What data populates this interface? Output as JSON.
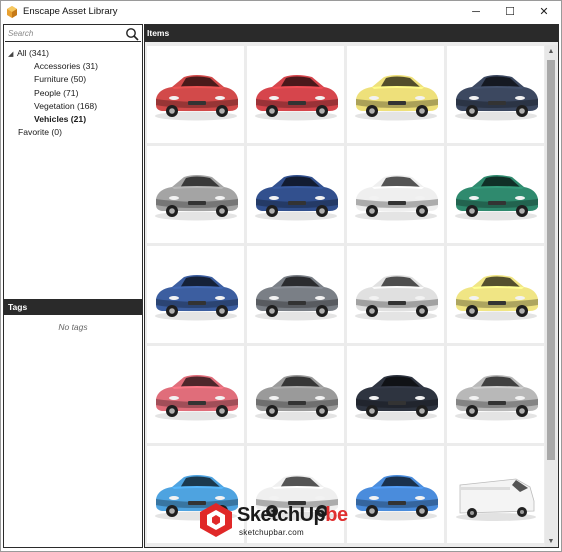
{
  "window": {
    "title": "Enscape Asset Library",
    "min_glyph": "─",
    "max_glyph": "☐",
    "close_glyph": "✕"
  },
  "search": {
    "placeholder": "Search",
    "value": ""
  },
  "tree": {
    "root": "All (341)",
    "children": [
      "Accessories (31)",
      "Furniture (50)",
      "People (71)",
      "Vegetation (168)",
      "Vehicles (21)"
    ],
    "selected": "Vehicles (21)",
    "favorite": "Favorite (0)"
  },
  "tags": {
    "header": "Tags",
    "empty_text": "No tags"
  },
  "items": {
    "header": "Items",
    "cars": [
      {
        "name": "car-1",
        "color": "#d24a4a"
      },
      {
        "name": "car-2",
        "color": "#d6454c"
      },
      {
        "name": "car-3",
        "color": "#eee07a"
      },
      {
        "name": "car-4",
        "color": "#3c4860"
      },
      {
        "name": "car-5",
        "color": "#a4a4a4"
      },
      {
        "name": "car-6",
        "color": "#32508e"
      },
      {
        "name": "car-7",
        "color": "#efefef"
      },
      {
        "name": "car-8",
        "color": "#2f8a6e"
      },
      {
        "name": "car-9",
        "color": "#3c5ea0"
      },
      {
        "name": "car-10",
        "color": "#7a7f86"
      },
      {
        "name": "car-11",
        "color": "#e0e0e0"
      },
      {
        "name": "car-12",
        "color": "#f0e584"
      },
      {
        "name": "car-13",
        "color": "#e06d7a"
      },
      {
        "name": "car-14",
        "color": "#9a9a9a"
      },
      {
        "name": "car-15",
        "color": "#2e3440"
      },
      {
        "name": "car-16",
        "color": "#b8b8b8"
      },
      {
        "name": "car-17",
        "color": "#4ea3e0"
      },
      {
        "name": "car-18",
        "color": "#efefef"
      },
      {
        "name": "car-19",
        "color": "#4a8cdc"
      },
      {
        "name": "car-20",
        "color": "#f4f4f4"
      }
    ]
  },
  "watermark": {
    "brand_main": "SketchUp",
    "brand_suffix": "be",
    "url": "sketchupbar.com"
  },
  "colors": {
    "header_bg": "#2a2a2a",
    "grid_bg": "#ececec",
    "scroll_thumb": "#a8a8a8",
    "brand_red": "#e03030"
  }
}
